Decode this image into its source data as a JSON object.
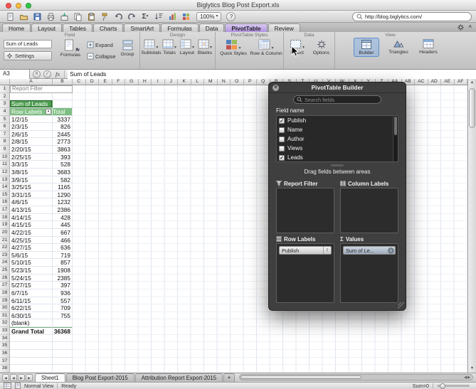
{
  "window": {
    "title": "Biglytics Blog Post Export.xls"
  },
  "toolbar": {
    "zoom": "100%",
    "search_value": "http://blog.biglytics.com/",
    "icon_names": [
      "new-workbook",
      "open",
      "save",
      "print",
      "import",
      "copy",
      "paste",
      "format-painter",
      "undo",
      "redo",
      "autosum",
      "sort",
      "chart",
      "gallery"
    ]
  },
  "icons": {
    "caret_down": "▾",
    "check": "✓",
    "close": "✕",
    "help": "?",
    "updown": "↕",
    "info": "i",
    "arrow_up": "▲",
    "arrow_down": "▼",
    "arrow_left": "◀",
    "arrow_right": "▶",
    "sigma": "Σ",
    "cancel": "✕",
    "enter": "✓",
    "collapse_ribbon": "^",
    "fx": "fx"
  },
  "ribbon": {
    "tabs": [
      "Home",
      "Layout",
      "Tables",
      "Charts",
      "SmartArt",
      "Formulas",
      "Data",
      "PivotTable",
      "Review"
    ],
    "active_tab": "PivotTable",
    "groups": {
      "field": {
        "label": "Field",
        "field_name": "Sum of Leads",
        "settings": "Settings",
        "formulas": "Formulas",
        "expand": "Expand",
        "collapse": "Collapse",
        "group": "Group"
      },
      "design": {
        "label": "Design",
        "buttons": [
          "Subtotals",
          "Totals",
          "Layout",
          "Blanks"
        ]
      },
      "styles": {
        "label": "PivotTable Styles",
        "buttons": [
          "Quick Styles",
          "Row & Column"
        ]
      },
      "data": {
        "label": "Data",
        "buttons": [
          "Select",
          "Options"
        ]
      },
      "view": {
        "label": "View",
        "buttons": [
          "Builder",
          "Triangles",
          "Headers"
        ],
        "active": "Builder"
      }
    }
  },
  "formula_bar": {
    "cell_ref": "A3",
    "fx_label": "fx",
    "value": "Sum of Leads"
  },
  "grid": {
    "columns": [
      "A",
      "B",
      "C",
      "D",
      "E",
      "F",
      "G",
      "H",
      "I",
      "J",
      "K",
      "L",
      "M",
      "N",
      "O",
      "P",
      "Q",
      "R",
      "S",
      "T",
      "U",
      "V",
      "W",
      "X",
      "Y",
      "Z",
      "AA",
      "AB",
      "AC",
      "AD",
      "AE",
      "AF"
    ],
    "visible_rows": 38,
    "report_filter_label": "Report Filter",
    "pivot_title": "Sum of Leads",
    "header": {
      "row_label": "Row Labels",
      "total": "Total"
    },
    "rows": [
      [
        "1/2/15",
        "3337"
      ],
      [
        "2/3/15",
        "826"
      ],
      [
        "2/6/15",
        "2445"
      ],
      [
        "2/8/15",
        "2773"
      ],
      [
        "2/20/15",
        "3863"
      ],
      [
        "2/25/15",
        "393"
      ],
      [
        "3/3/15",
        "528"
      ],
      [
        "3/8/15",
        "3683"
      ],
      [
        "3/9/15",
        "582"
      ],
      [
        "3/25/15",
        "1165"
      ],
      [
        "3/31/15",
        "1290"
      ],
      [
        "4/6/15",
        "1232"
      ],
      [
        "4/13/15",
        "2386"
      ],
      [
        "4/14/15",
        "428"
      ],
      [
        "4/15/15",
        "445"
      ],
      [
        "4/22/15",
        "667"
      ],
      [
        "4/25/15",
        "466"
      ],
      [
        "4/27/15",
        "636"
      ],
      [
        "5/6/15",
        "719"
      ],
      [
        "5/10/15",
        "857"
      ],
      [
        "5/23/15",
        "1908"
      ],
      [
        "5/24/15",
        "2385"
      ],
      [
        "5/27/15",
        "397"
      ],
      [
        "6/7/15",
        "936"
      ],
      [
        "6/11/15",
        "557"
      ],
      [
        "6/22/15",
        "709"
      ],
      [
        "6/30/15",
        "755"
      ]
    ],
    "blank_row": 32,
    "blank_row_label": "(blank)",
    "grand_total_row": 33,
    "grand_total_label": "Grand Total",
    "grand_total_value": "36368"
  },
  "builder": {
    "title": "PivotTable Builder",
    "search_placeholder": "Search fields",
    "field_name_label": "Field name",
    "fields": [
      {
        "name": "Publish",
        "checked": true
      },
      {
        "name": "Name",
        "checked": false
      },
      {
        "name": "Author",
        "checked": false
      },
      {
        "name": "Views",
        "checked": false
      },
      {
        "name": "Leads",
        "checked": true
      }
    ],
    "drag_hint": "Drag fields between areas",
    "areas": {
      "report_filter": {
        "label": "Report Filter",
        "items": []
      },
      "column_labels": {
        "label": "Column Labels",
        "items": []
      },
      "row_labels": {
        "label": "Row Labels",
        "items": [
          "Publish"
        ]
      },
      "values": {
        "label": "Values",
        "items": [
          "Sum of Le..."
        ]
      }
    }
  },
  "sheet_tabs": {
    "tabs": [
      "Sheet1",
      "Blog Post Export-2015",
      "Attribution Report Export-2015"
    ],
    "active": "Sheet1",
    "add_label": "+"
  },
  "status_bar": {
    "view_label": "Normal View",
    "status": "Ready",
    "sum": "Sum=0"
  },
  "colors": {
    "pivot_header_green": "#4e9d50",
    "pivot_subheader_green": "#7fbe82",
    "active_tab_purple": "#c2a8e4",
    "builder_active_blue": "#8fb6e8"
  }
}
